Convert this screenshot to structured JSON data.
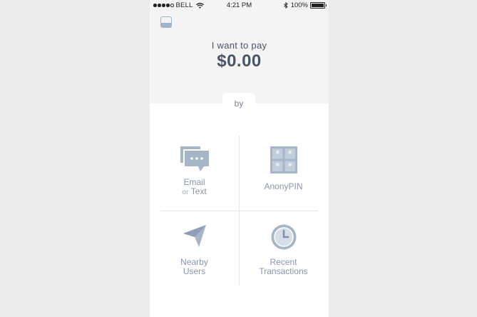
{
  "status_bar": {
    "carrier": "BELL",
    "time": "4:21 PM",
    "battery": "100%",
    "signal_dots": 5,
    "signal_filled": 4
  },
  "header": {
    "prompt": "I want to pay",
    "amount": "$0.00"
  },
  "by_label": "by",
  "options": {
    "email_text": {
      "line1": "Email",
      "line2_prefix": "or",
      "line2": "Text",
      "icon": "chat-bubble-icon"
    },
    "anonypin": {
      "label": "AnonyPIN",
      "icon": "pin-keypad-icon"
    },
    "nearby": {
      "line1": "Nearby",
      "line2": "Users",
      "icon": "location-arrow-icon"
    },
    "recent": {
      "line1": "Recent",
      "line2": "Transactions",
      "icon": "clock-icon"
    }
  },
  "colors": {
    "icon": "#a7b5c8",
    "text": "#8a94a6",
    "heading": "#4a5563",
    "header_bg": "#f4f4f4"
  }
}
